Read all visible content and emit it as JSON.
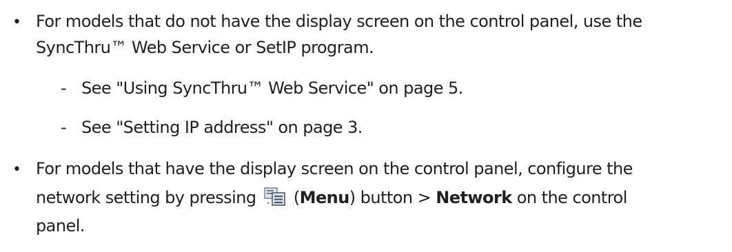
{
  "items": [
    {
      "bullet": "•",
      "line1": "For models that do not have the display screen on the control panel, use the",
      "line2": "SyncThru™ Web Service or SetIP program.",
      "sub_items": [
        {
          "dash": "-",
          "text": "See \"Using SyncThru™ Web Service\" on page 5."
        },
        {
          "dash": "-",
          "text": "See \"Setting IP address\" on page 3."
        }
      ]
    },
    {
      "bullet": "•",
      "line1": "For models that have the display screen on the control panel, configure the",
      "line2_before_icon": "network setting by pressing",
      "line2_paren_open": " (",
      "line2_menu": "Menu",
      "line2_after_menu": ") button > ",
      "line2_network": "Network",
      "line2_end": " on the control",
      "line3": "panel.",
      "icon": "menu-icon"
    }
  ]
}
